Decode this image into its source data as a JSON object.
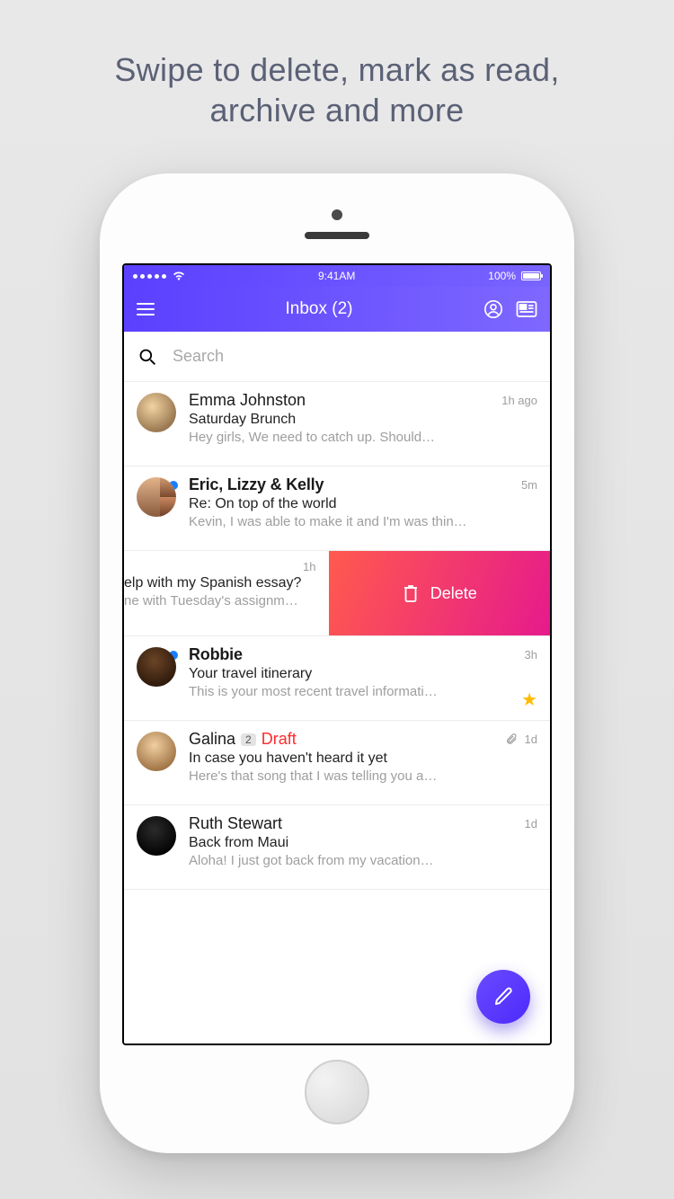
{
  "promo_line1": "Swipe to delete, mark as read,",
  "promo_line2": "archive and more",
  "status": {
    "time": "9:41AM",
    "battery_pct": "100%"
  },
  "header": {
    "title": "Inbox (2)"
  },
  "search": {
    "placeholder": "Search"
  },
  "actions": {
    "delete_label": "Delete"
  },
  "emails": [
    {
      "sender": "Emma Johnston",
      "subject": "Saturday Brunch",
      "snippet": "Hey girls, We need to catch up. Should…",
      "time": "1h ago",
      "unread": false
    },
    {
      "sender": "Eric, Lizzy & Kelly",
      "subject": "Re: On top of the world",
      "snippet": "Kevin, I was able to make it and I'm was thin…",
      "time": "5m",
      "unread": true
    },
    {
      "subject": "elp with my Spanish essay?",
      "snippet": "ne with Tuesday's assignm…",
      "time": "1h"
    },
    {
      "sender": "Robbie",
      "subject": "Your travel itinerary",
      "snippet": "This is your most recent travel informati…",
      "time": "3h",
      "unread": true,
      "starred": true
    },
    {
      "sender": "Galina",
      "count": "2",
      "draft_label": "Draft",
      "subject": "In case you haven't heard it yet",
      "snippet": "Here's that song that I was telling you a…",
      "time": "1d",
      "attachment": true
    },
    {
      "sender": "Ruth Stewart",
      "subject": "Back from Maui",
      "snippet": "Aloha! I just got back from my vacation…",
      "time": "1d"
    }
  ]
}
